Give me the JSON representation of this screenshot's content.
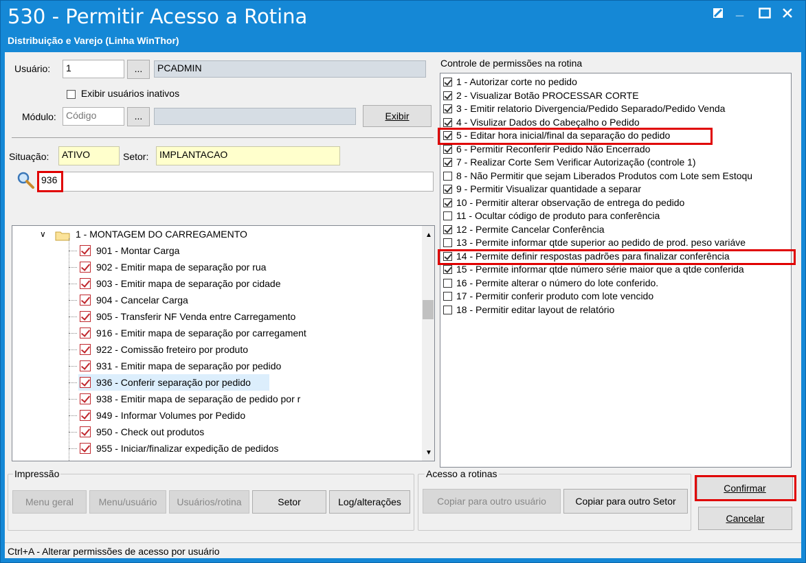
{
  "window": {
    "title": "530 - Permitir Acesso a Rotina",
    "subtitle": "Distribuição e Varejo (Linha WinThor)"
  },
  "user": {
    "label": "Usuário:",
    "code": "1",
    "lookup_label": "...",
    "name": "PCADMIN",
    "show_inactive_label": "Exibir usuários inativos"
  },
  "module": {
    "label": "Módulo:",
    "code_placeholder": "Código",
    "lookup_label": "...",
    "show_button": "Exibir"
  },
  "situacao": {
    "label": "Situação:",
    "value": "ATIVO"
  },
  "setor": {
    "label": "Setor:",
    "value": "IMPLANTACAO"
  },
  "search": {
    "value": "936"
  },
  "tree": {
    "group_label": "1 - MONTAGEM DO CARREGAMENTO",
    "items": [
      {
        "label": "901 - Montar Carga"
      },
      {
        "label": "902 - Emitir mapa de separação por rua"
      },
      {
        "label": "903 - Emitir mapa de separação por cidade"
      },
      {
        "label": "904 - Cancelar Carga"
      },
      {
        "label": "905 - Transferir NF Venda entre Carregamento"
      },
      {
        "label": "916 - Emitir mapa de separação por carregament"
      },
      {
        "label": "922 - Comissão freteiro por produto"
      },
      {
        "label": "931 - Emitir mapa de separação por pedido"
      },
      {
        "label": "936 - Conferir separação por pedido"
      },
      {
        "label": "938 - Emitir mapa de separação de pedido por r"
      },
      {
        "label": "949 - Informar Volumes por Pedido"
      },
      {
        "label": "950 - Check out produtos"
      },
      {
        "label": "955 - Iniciar/finalizar expedição de pedidos"
      }
    ]
  },
  "permissions": {
    "title": "Controle de permissões na rotina",
    "items": [
      {
        "label": "1 - Autorizar corte no pedido",
        "checked": true
      },
      {
        "label": "2 - Visualizar Botão PROCESSAR CORTE",
        "checked": true
      },
      {
        "label": "3 - Emitir relatorio Divergencia/Pedido Separado/Pedido Venda",
        "checked": true
      },
      {
        "label": "4 - Visulizar Dados do Cabeçalho o Pedido",
        "checked": true
      },
      {
        "label": "5 - Editar hora inicial/final da separação do pedido",
        "checked": true
      },
      {
        "label": "6 - Permitir Reconferir Pedido Não Encerrado",
        "checked": true
      },
      {
        "label": "7 - Realizar Corte Sem Verificar Autorização (controle 1)",
        "checked": true
      },
      {
        "label": "8 - Não Permitir que sejam Liberados Produtos com Lote sem Estoqu",
        "checked": false
      },
      {
        "label": "9 - Permitir Visualizar quantidade a separar",
        "checked": true
      },
      {
        "label": "10 - Permitir alterar observação de entrega do pedido",
        "checked": true
      },
      {
        "label": "11 - Ocultar código de produto para conferência",
        "checked": false
      },
      {
        "label": "12 - Permite Cancelar Conferência",
        "checked": true
      },
      {
        "label": "13 - Permite informar qtde superior ao pedido de prod. peso variáve",
        "checked": false
      },
      {
        "label": "14 - Permite definir respostas padrões para finalizar conferência",
        "checked": true
      },
      {
        "label": "15 - Permite informar qtde número série maior que a qtde conferida",
        "checked": true
      },
      {
        "label": "16 - Permite alterar o número do lote conferido.",
        "checked": false
      },
      {
        "label": "17 - Permitir conferir produto com lote vencido",
        "checked": false
      },
      {
        "label": "18 - Permitir editar layout de relatório",
        "checked": false
      }
    ]
  },
  "impressao": {
    "label": "Impressão",
    "buttons": [
      "Menu geral",
      "Menu/usuário",
      "Usuários/rotina",
      "Setor",
      "Log/alterações"
    ]
  },
  "acesso": {
    "label": "Acesso a rotinas",
    "buttons": [
      "Copiar para outro usuário",
      "Copiar para outro Setor"
    ]
  },
  "actions": {
    "confirm": "Confirmar",
    "cancel": "Cancelar"
  },
  "status": {
    "text": "Ctrl+A - Alterar permissões de acesso por usuário"
  },
  "colors": {
    "titlebar": "#1588d6",
    "highlight": "#e00000",
    "tree_check": "#c0272d"
  }
}
